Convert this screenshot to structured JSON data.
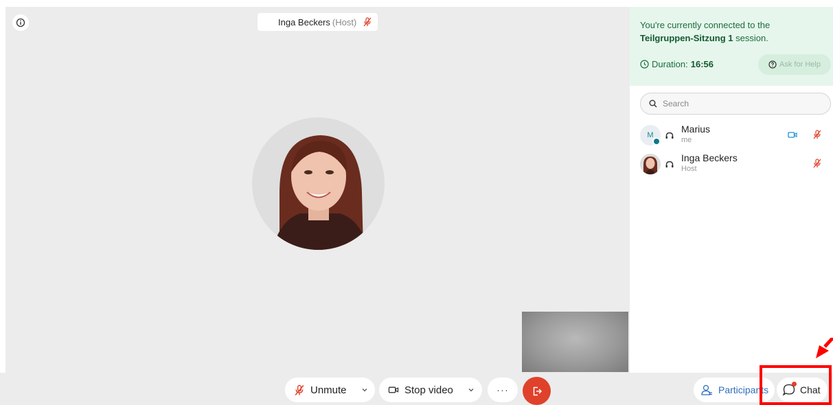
{
  "header": {
    "speaker_name": "Inga Beckers",
    "speaker_role": "(Host)"
  },
  "session": {
    "connected_prefix": "You're currently connected to the",
    "session_name": "Teilgruppen-Sitzung 1",
    "session_suffix": " session.",
    "duration_label": "Duration:",
    "duration_value": "16:56",
    "help_label": "Ask for Help"
  },
  "search": {
    "placeholder": "Search"
  },
  "participants": [
    {
      "initial": "M",
      "name": "Marius",
      "subtitle": "me",
      "camera_on": true,
      "muted": true
    },
    {
      "name": "Inga Beckers",
      "subtitle": "Host",
      "camera_on": false,
      "muted": true
    }
  ],
  "controls": {
    "unmute_label": "Unmute",
    "stop_video_label": "Stop video",
    "more_label": "···",
    "participants_label": "Participants",
    "chat_label": "Chat"
  },
  "colors": {
    "accent_green": "#1b6d3c",
    "session_bg": "#e6f6ec",
    "mute_red": "#e0412b",
    "link_blue": "#2f6fba",
    "highlight_red": "#ff0000"
  },
  "icons": [
    "info-icon",
    "mic-off-icon",
    "clock-icon",
    "help-icon",
    "search-icon",
    "headset-icon",
    "camera-icon",
    "chevron-down-icon",
    "leave-icon",
    "participants-icon",
    "chat-icon",
    "arrow-icon"
  ]
}
